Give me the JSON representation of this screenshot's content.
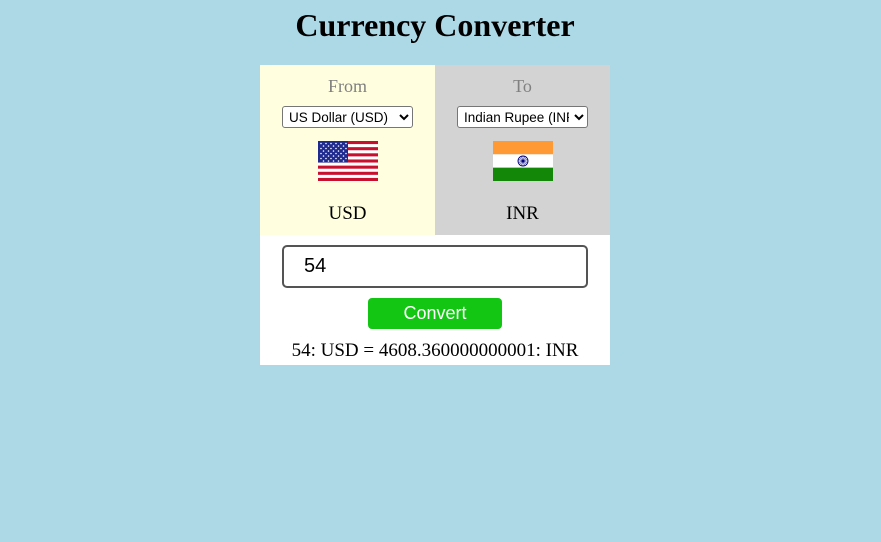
{
  "header": {
    "title": "Currency Converter"
  },
  "from": {
    "label": "From",
    "selected_option": "US Dollar (USD)",
    "code": "USD",
    "flag_icon": "us-flag-icon",
    "background": "#ffffe0"
  },
  "to": {
    "label": "To",
    "selected_option": "Indian Rupee (INR)",
    "code": "INR",
    "flag_icon": "india-flag-icon",
    "background": "#d3d3d3"
  },
  "amount": {
    "value": "54"
  },
  "convert": {
    "label": "Convert",
    "color": "#14c614"
  },
  "result": {
    "text": "54: USD = 4608.360000000001: INR"
  },
  "colors": {
    "page_background": "#add8e6",
    "card_background": "#ffffff"
  }
}
